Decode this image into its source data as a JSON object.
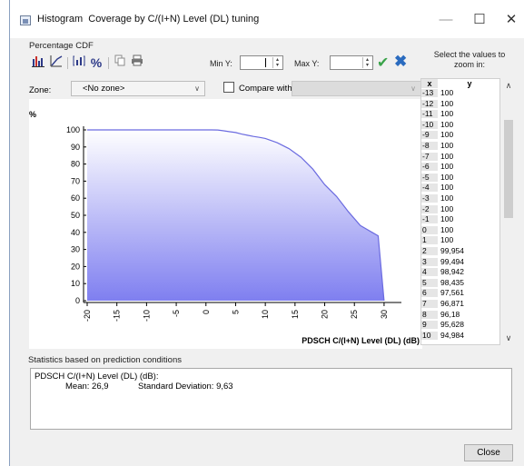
{
  "window": {
    "title": "Histogram",
    "subtitle": "Coverage by C/(I+N) Level (DL) tuning",
    "controls": {
      "minimize": "—",
      "maximize": "☐",
      "close": "✕"
    }
  },
  "panel": {
    "title": "Percentage CDF",
    "toolbar": {
      "percent_label": "%",
      "min_y_label": "Min Y:",
      "max_y_label": "Max Y:",
      "min_y_value": "",
      "max_y_value": ""
    },
    "zone_label": "Zone:",
    "zone_value": "<No zone>",
    "compare_label": "Compare with:",
    "compare_value": ""
  },
  "zoom": {
    "title": "Select the values to zoom in:",
    "col_x": "x",
    "col_y": "y",
    "rows": [
      {
        "x": "-13",
        "y": "100"
      },
      {
        "x": "-12",
        "y": "100"
      },
      {
        "x": "-11",
        "y": "100"
      },
      {
        "x": "-10",
        "y": "100"
      },
      {
        "x": "-9",
        "y": "100"
      },
      {
        "x": "-8",
        "y": "100"
      },
      {
        "x": "-7",
        "y": "100"
      },
      {
        "x": "-6",
        "y": "100"
      },
      {
        "x": "-5",
        "y": "100"
      },
      {
        "x": "-4",
        "y": "100"
      },
      {
        "x": "-3",
        "y": "100"
      },
      {
        "x": "-2",
        "y": "100"
      },
      {
        "x": "-1",
        "y": "100"
      },
      {
        "x": "0",
        "y": "100"
      },
      {
        "x": "1",
        "y": "100"
      },
      {
        "x": "2",
        "y": "99,954"
      },
      {
        "x": "3",
        "y": "99,494"
      },
      {
        "x": "4",
        "y": "98,942"
      },
      {
        "x": "5",
        "y": "98,435"
      },
      {
        "x": "6",
        "y": "97,561"
      },
      {
        "x": "7",
        "y": "96,871"
      },
      {
        "x": "8",
        "y": "96,18"
      },
      {
        "x": "9",
        "y": "95,628"
      },
      {
        "x": "10",
        "y": "94,984"
      }
    ]
  },
  "chart_data": {
    "type": "area",
    "title": "",
    "ylabel": "%",
    "xlabel": "PDSCH C/(I+N) Level (DL) (dB)",
    "xlim": [
      -20,
      32
    ],
    "ylim": [
      0,
      100
    ],
    "x_ticks": [
      "-20",
      "-15",
      "-10",
      "-5",
      "0",
      "5",
      "10",
      "15",
      "20",
      "25",
      "30"
    ],
    "y_ticks": [
      "0",
      "10",
      "20",
      "30",
      "40",
      "50",
      "60",
      "70",
      "80",
      "90",
      "100"
    ],
    "x": [
      -20,
      -13,
      -5,
      0,
      1,
      2,
      3,
      4,
      5,
      6,
      7,
      8,
      9,
      10,
      12,
      14,
      16,
      18,
      20,
      22,
      24,
      26,
      28,
      29,
      30
    ],
    "values": [
      100,
      100,
      100,
      100,
      100,
      99.954,
      99.494,
      98.942,
      98.435,
      97.561,
      96.871,
      96.18,
      95.628,
      94.984,
      92.5,
      89,
      84,
      77,
      68,
      61,
      52,
      44,
      40,
      38,
      0
    ],
    "colors": {
      "fill_top": "#ffffff",
      "fill_bottom": "#7f7ff0",
      "line": "#6b6be0"
    }
  },
  "stats": {
    "title": "Statistics based on prediction conditions",
    "metric": "PDSCH C/(I+N) Level (DL) (dB):",
    "mean_label": "Mean: 26,9",
    "std_label": "Standard Deviation: 9,63"
  },
  "buttons": {
    "close": "Close"
  }
}
